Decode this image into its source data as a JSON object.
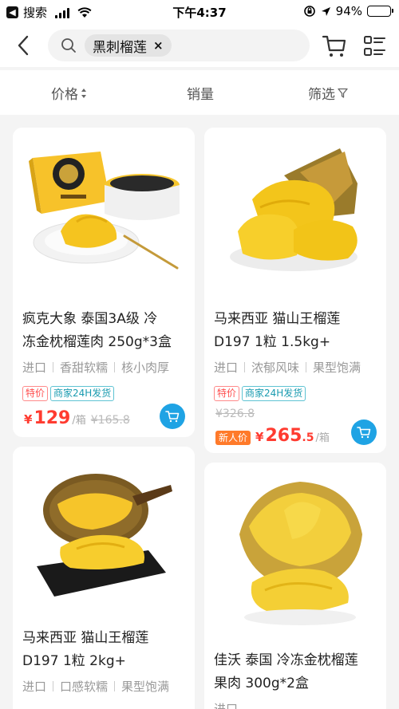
{
  "status_bar": {
    "back_app_label": "搜索",
    "time": "下午4:37",
    "battery": "94%",
    "battery_level": 0.94
  },
  "search": {
    "query": "黑刺榴莲",
    "clear_symbol": "×"
  },
  "filters": {
    "price": "价格",
    "sales": "销量",
    "filter": "筛选"
  },
  "products": [
    {
      "title_line1": "疯克大象 泰国3A级 冷",
      "title_line2": "冻金枕榴莲肉 250g*3盒",
      "attrs": [
        "进口",
        "香甜软糯",
        "核小肉厚"
      ],
      "tags": [
        "特价",
        "商家24H发货"
      ],
      "currency": "¥",
      "price_int": "129",
      "price_dec": "",
      "unit": "/箱",
      "orig_price": "¥165.8"
    },
    {
      "title_line1": "马来西亚 猫山王榴莲",
      "title_line2": "D197 1粒 1.5kg+",
      "attrs": [
        "进口",
        "浓郁风味",
        "果型饱满"
      ],
      "tags": [
        "特价",
        "商家24H发货"
      ],
      "orig_price": "¥326.8",
      "badge": "新人价",
      "currency": "¥",
      "price_int": "265",
      "price_dec": ".5",
      "unit": "/箱"
    },
    {
      "title_line1": "马来西亚 猫山王榴莲",
      "title_line2": "D197 1粒 2kg+",
      "attrs": [
        "进口",
        "口感软糯",
        "果型饱满"
      ]
    },
    {
      "title_line1": "佳沃 泰国 冷冻金枕榴莲",
      "title_line2": "果肉 300g*2盒",
      "attrs": [
        "进口"
      ]
    }
  ],
  "colors": {
    "price_red": "#ff3b30",
    "cart_blue": "#1fa3e4",
    "tag_teal": "#1a9bb0",
    "newbie_orange": "#ff7a2a"
  }
}
